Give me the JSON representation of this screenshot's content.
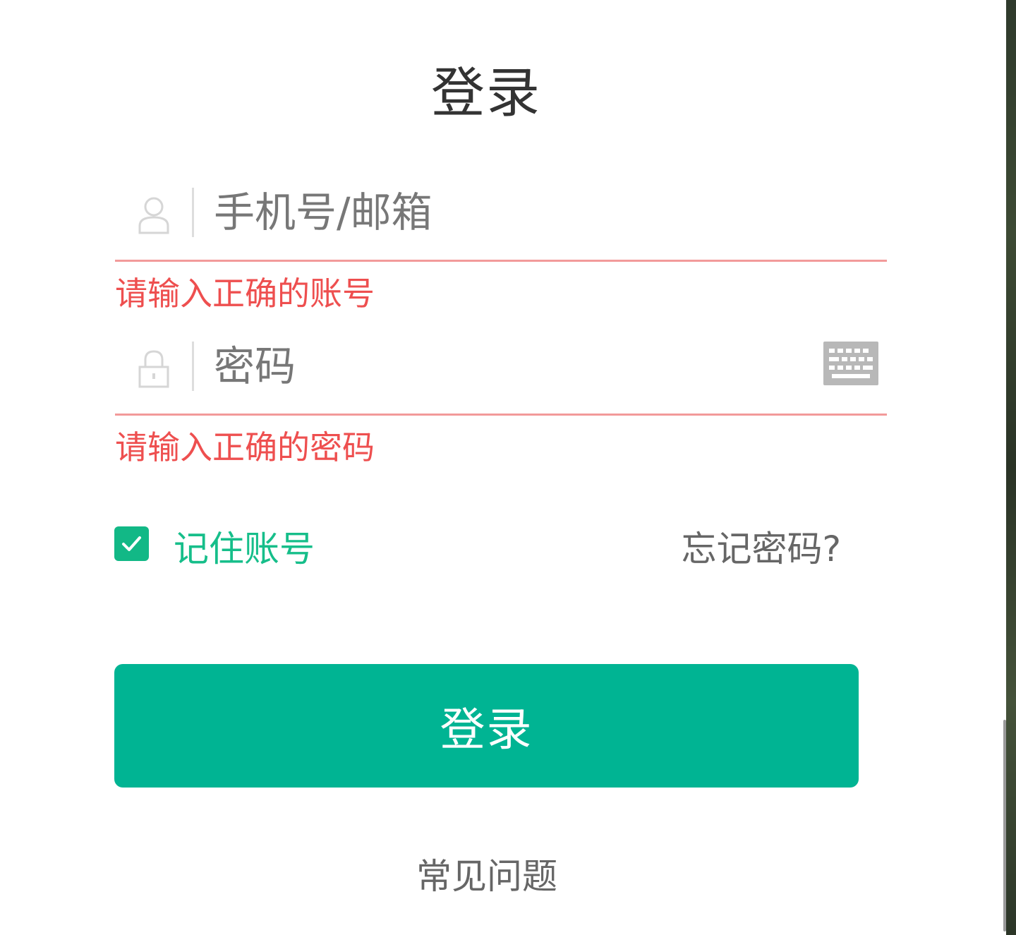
{
  "page": {
    "title": "登录"
  },
  "username": {
    "placeholder": "手机号/邮箱",
    "value": "",
    "icon": "user-icon",
    "error": "请输入正确的账号"
  },
  "password": {
    "placeholder": "密码",
    "value": "",
    "icon": "lock-icon",
    "keyboard_icon": "keyboard-icon",
    "error": "请输入正确的密码"
  },
  "remember": {
    "label": "记住账号",
    "checked": true
  },
  "forgot": {
    "label": "忘记密码?"
  },
  "login_button": {
    "label": "登录"
  },
  "faq": {
    "label": "常见问题"
  },
  "colors": {
    "accent": "#00b493",
    "remember_text": "#16be8a",
    "error": "#ee4f4f",
    "error_underline": "#f29a9a"
  }
}
